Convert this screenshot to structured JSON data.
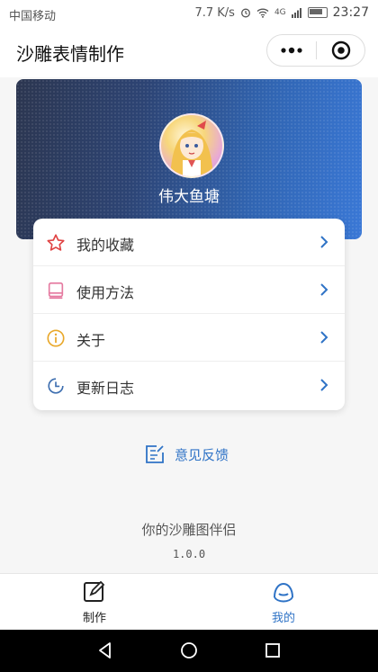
{
  "status_bar": {
    "carrier": "中国移动",
    "speed": "7.7 K/s",
    "network": "4G",
    "time": "23:27"
  },
  "header": {
    "title": "沙雕表情制作"
  },
  "profile": {
    "username": "伟大鱼塘"
  },
  "menu": {
    "items": [
      {
        "label": "我的收藏",
        "icon": "star-icon",
        "color": "#e04343"
      },
      {
        "label": "使用方法",
        "icon": "book-icon",
        "color": "#e57aa0"
      },
      {
        "label": "关于",
        "icon": "info-icon",
        "color": "#e9a82a"
      },
      {
        "label": "更新日志",
        "icon": "clock-icon",
        "color": "#3e6fb0"
      }
    ]
  },
  "feedback": {
    "label": "意见反馈"
  },
  "footer": {
    "tagline": "你的沙雕图伴侣",
    "version": "1.0.0"
  },
  "tabbar": {
    "tabs": [
      {
        "label": "制作",
        "icon": "edit-icon",
        "active": false
      },
      {
        "label": "我的",
        "icon": "profile-icon",
        "active": true
      }
    ]
  },
  "colors": {
    "accent": "#2f73c6",
    "banner_start": "#2c3650",
    "banner_end": "#3a78d6",
    "tab_inactive": "#222222"
  }
}
